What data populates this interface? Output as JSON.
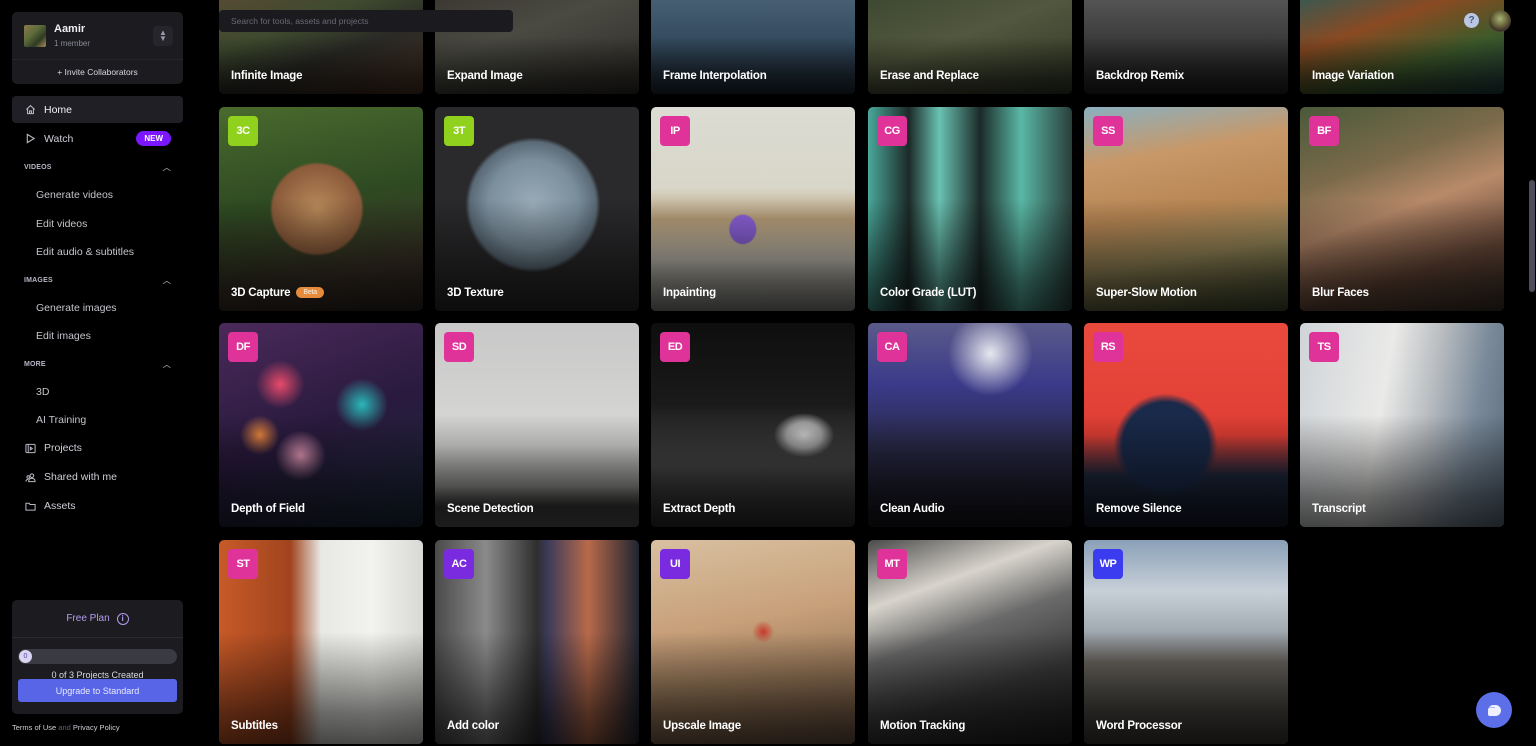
{
  "team": {
    "name": "Aamir",
    "members": "1 member",
    "invite_label": "+ Invite Collaborators"
  },
  "nav": {
    "home": "Home",
    "watch": "Watch",
    "watch_badge": "NEW",
    "sections": [
      {
        "title": "VIDEOS",
        "items": [
          "Generate videos",
          "Edit videos",
          "Edit audio & subtitles"
        ]
      },
      {
        "title": "IMAGES",
        "items": [
          "Generate images",
          "Edit images"
        ]
      },
      {
        "title": "MORE",
        "items": [
          "3D",
          "AI Training"
        ]
      }
    ],
    "projects": "Projects",
    "shared": "Shared with me",
    "assets": "Assets"
  },
  "plan": {
    "title": "Free Plan",
    "progress_value": "0",
    "progress_fraction": 0,
    "status": "0 of 3 Projects Created",
    "upgrade_label": "Upgrade to Standard"
  },
  "legal": {
    "terms": "Terms of Use",
    "and": "and",
    "privacy": "Privacy Policy"
  },
  "search": {
    "placeholder": "Search for tools, assets and projects"
  },
  "help_label": "?",
  "colors": {
    "accent_purple": "#7b17ff",
    "upgrade_blue": "#5865e6",
    "badge_green": "#8fd11d",
    "badge_pink": "#e0339a",
    "badge_purple": "#7a2be0",
    "badge_blue": "#3b3cf0",
    "beta_orange": "#e68a3c"
  },
  "tools": [
    {
      "title": "Infinite Image",
      "abbr": "",
      "badge_color": ""
    },
    {
      "title": "Expand Image",
      "abbr": "",
      "badge_color": ""
    },
    {
      "title": "Frame Interpolation",
      "abbr": "",
      "badge_color": ""
    },
    {
      "title": "Erase and Replace",
      "abbr": "",
      "badge_color": ""
    },
    {
      "title": "Backdrop Remix",
      "abbr": "",
      "badge_color": ""
    },
    {
      "title": "Image Variation",
      "abbr": "",
      "badge_color": ""
    },
    {
      "title": "3D Capture",
      "abbr": "3C",
      "badge_color": "#8fd11d",
      "tag": "Beta"
    },
    {
      "title": "3D Texture",
      "abbr": "3T",
      "badge_color": "#8fd11d"
    },
    {
      "title": "Inpainting",
      "abbr": "IP",
      "badge_color": "#e0339a"
    },
    {
      "title": "Color Grade (LUT)",
      "abbr": "CG",
      "badge_color": "#e0339a"
    },
    {
      "title": "Super-Slow Motion",
      "abbr": "SS",
      "badge_color": "#e0339a"
    },
    {
      "title": "Blur Faces",
      "abbr": "BF",
      "badge_color": "#e0339a"
    },
    {
      "title": "Depth of Field",
      "abbr": "DF",
      "badge_color": "#e0339a"
    },
    {
      "title": "Scene Detection",
      "abbr": "SD",
      "badge_color": "#e0339a"
    },
    {
      "title": "Extract Depth",
      "abbr": "ED",
      "badge_color": "#e0339a"
    },
    {
      "title": "Clean Audio",
      "abbr": "CA",
      "badge_color": "#e0339a"
    },
    {
      "title": "Remove Silence",
      "abbr": "RS",
      "badge_color": "#e0339a"
    },
    {
      "title": "Transcript",
      "abbr": "TS",
      "badge_color": "#e0339a"
    },
    {
      "title": "Subtitles",
      "abbr": "ST",
      "badge_color": "#e0339a"
    },
    {
      "title": "Add color",
      "abbr": "AC",
      "badge_color": "#7a2be0"
    },
    {
      "title": "Upscale Image",
      "abbr": "UI",
      "badge_color": "#7a2be0"
    },
    {
      "title": "Motion Tracking",
      "abbr": "MT",
      "badge_color": "#e0339a"
    },
    {
      "title": "Word Processor",
      "abbr": "WP",
      "badge_color": "#3b3cf0"
    }
  ]
}
